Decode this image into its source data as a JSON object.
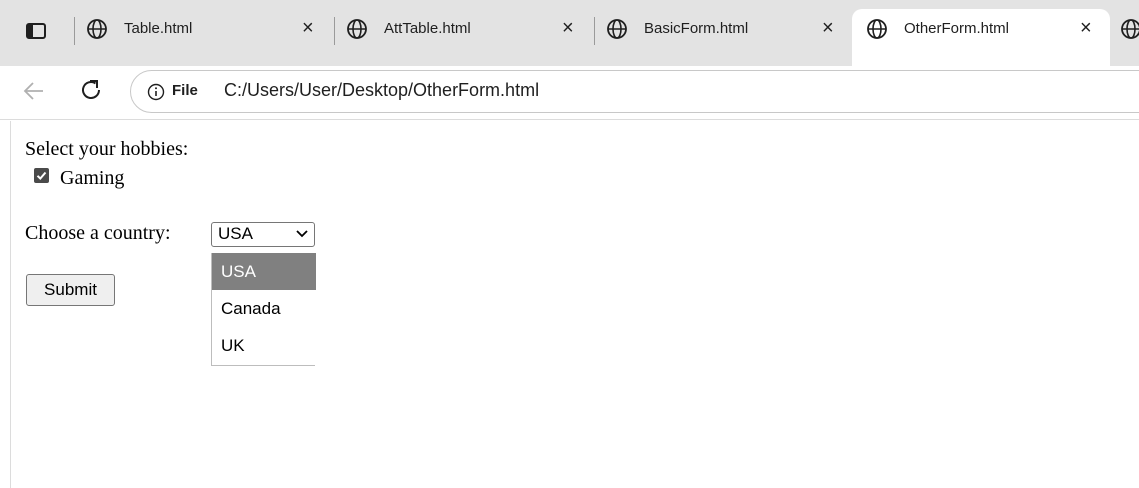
{
  "browser": {
    "tabs": [
      {
        "title": "Table.html",
        "close": "×",
        "active": false
      },
      {
        "title": "AttTable.html",
        "close": "×",
        "active": false
      },
      {
        "title": "BasicForm.html",
        "close": "×",
        "active": false
      },
      {
        "title": "OtherForm.html",
        "close": "×",
        "active": true
      }
    ],
    "address": {
      "chip": "File",
      "url": "C:/Users/User/Desktop/OtherForm.html"
    },
    "icons": [
      "tab-actions-icon",
      "globe-icon",
      "close-icon",
      "back-arrow-icon",
      "reload-icon",
      "info-icon"
    ]
  },
  "form": {
    "hobbies_label": "Select your hobbies:",
    "hobby_option": "Gaming",
    "hobby_checked": true,
    "country_label": "Choose a country:",
    "country_selected": "USA",
    "country_options": [
      "USA",
      "Canada",
      "UK"
    ],
    "submit_label": "Submit"
  },
  "colors": {
    "tabstrip_bg": "#e3e3e3",
    "selected_option_bg": "#808080",
    "checkbox_fill": "#4a4a4a"
  }
}
